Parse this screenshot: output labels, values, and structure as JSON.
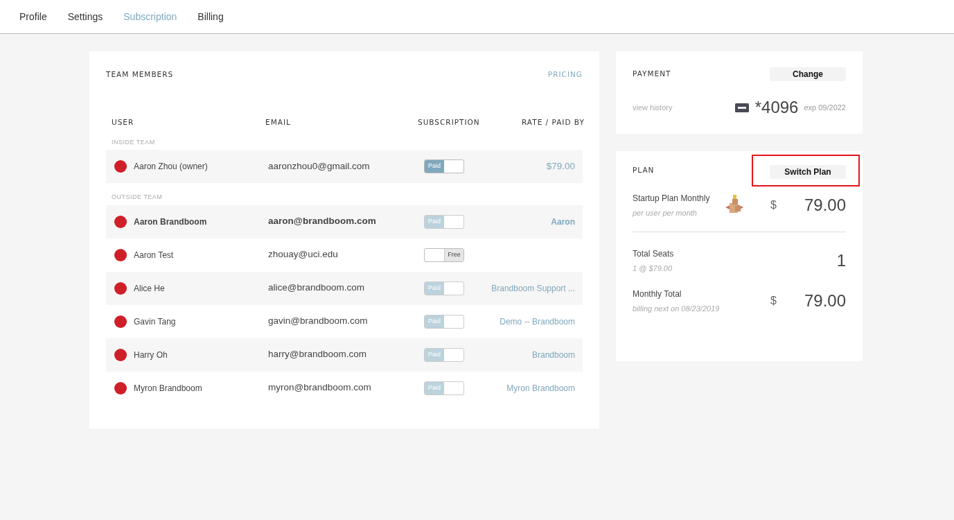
{
  "nav_tabs": [
    {
      "label": "Profile",
      "selected": false
    },
    {
      "label": "Settings",
      "selected": false
    },
    {
      "label": "Subscription",
      "selected": true
    },
    {
      "label": "Billing",
      "selected": false
    }
  ],
  "team_members": {
    "title": "TEAM MEMBERS",
    "pricing_link": "PRICING",
    "columns": [
      "USER",
      "EMAIL",
      "SUBSCRIPTION",
      "RATE / PAID BY"
    ],
    "groups": [
      {
        "label": "INSIDE TEAM",
        "members": [
          {
            "name": "Aaron Zhou (owner)",
            "email": "aaronzhou0@gmail.com",
            "color": "#cf1f28",
            "emphasized": false,
            "subscription": {
              "label": "Paid",
              "on": true,
              "disabled": false
            },
            "paid_by": "$79.00"
          }
        ]
      },
      {
        "label": "OUTSIDE TEAM",
        "members": [
          {
            "name": "Aaron Brandboom",
            "email": "aaron@brandboom.com",
            "color": "#cf1f28",
            "emphasized": true,
            "subscription": {
              "label": "Paid",
              "on": true,
              "disabled": true
            },
            "paid_by": "Aaron"
          },
          {
            "name": "Aaron Test",
            "email": "zhouay@uci.edu",
            "color": "#cf1f28",
            "emphasized": false,
            "subscription": {
              "label": "Free",
              "on": false,
              "disabled": false
            }
          },
          {
            "name": "Alice He",
            "email": "alice@brandboom.com",
            "color": "#cf1f28",
            "emphasized": false,
            "subscription": {
              "label": "Paid",
              "on": true,
              "disabled": true
            },
            "paid_by": "Brandboom Support ..."
          },
          {
            "name": "Gavin Tang",
            "email": "gavin@brandboom.com",
            "color": "#cf1f28",
            "emphasized": false,
            "subscription": {
              "label": "Paid",
              "on": true,
              "disabled": true
            },
            "paid_by": "Demo -- Brandboom"
          },
          {
            "name": "Harry Oh",
            "email": "harry@brandboom.com",
            "color": "#cf1f28",
            "emphasized": false,
            "subscription": {
              "label": "Paid",
              "on": true,
              "disabled": true
            },
            "paid_by": "Brandboom"
          },
          {
            "name": "Myron Brandboom",
            "email": "myron@brandboom.com",
            "color": "#cf1f28",
            "emphasized": false,
            "subscription": {
              "label": "Paid",
              "on": true,
              "disabled": true
            },
            "paid_by": "Myron Brandboom"
          }
        ]
      }
    ]
  },
  "payment": {
    "title": "PAYMENT",
    "button": "Change",
    "history_link": "view history",
    "card_number": "*4096",
    "expiry": "exp 09/2022"
  },
  "plan": {
    "title": "PLAN",
    "button": {
      "label": "Switch Plan",
      "highlighted": true
    },
    "plan_name": "Startup Plan Monthly",
    "plan_note": "per user per month",
    "currency": "$",
    "price": "79.00",
    "seats_label": "Total Seats",
    "seats_note": "1 @ $79.00",
    "seats": "1",
    "total_label": "Monthly Total",
    "total_note": "billing next on 08/23/2019",
    "total_currency": "$",
    "total": "79.00"
  }
}
